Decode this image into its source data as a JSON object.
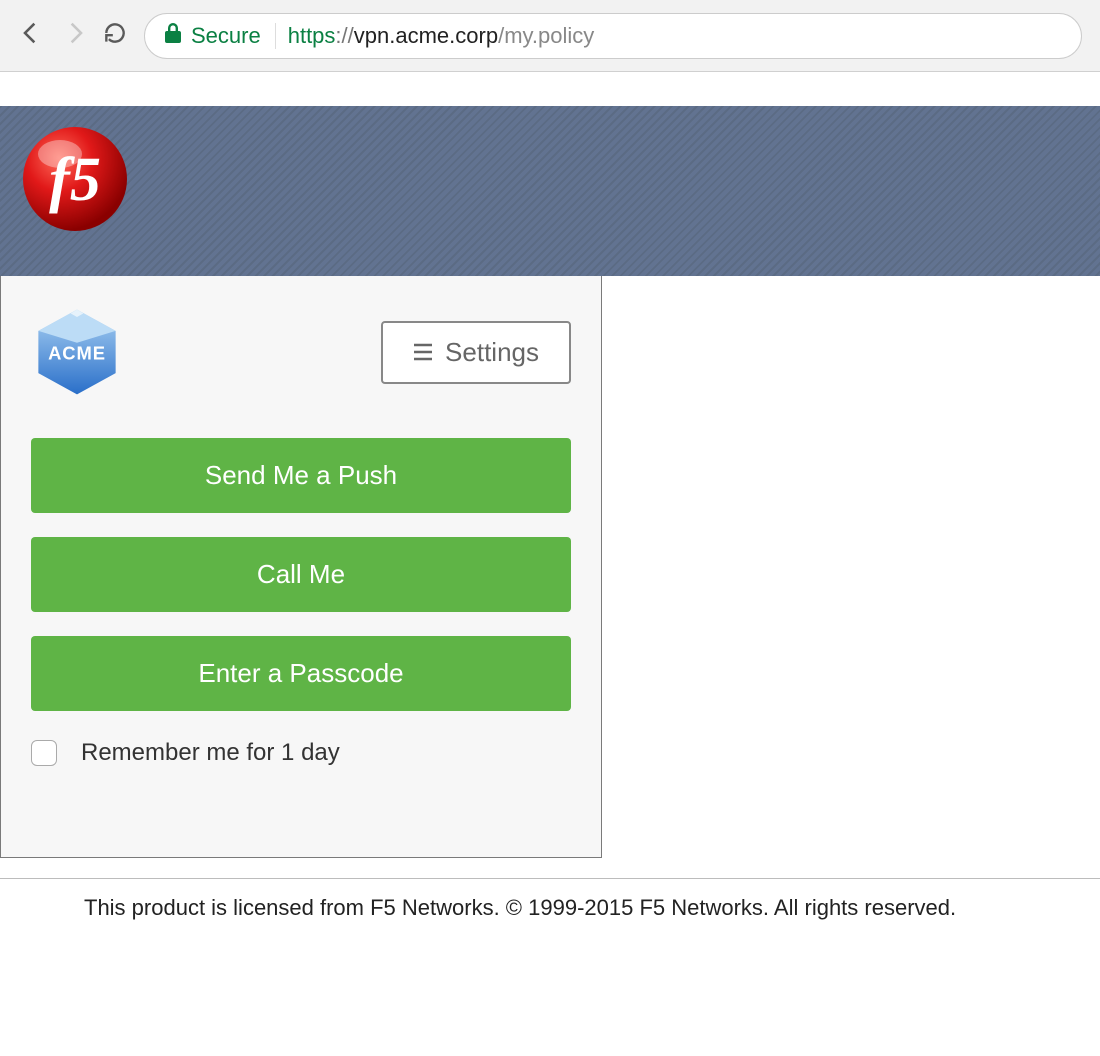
{
  "browser": {
    "secure_label": "Secure",
    "url": {
      "scheme": "https",
      "host": "vpn.acme.corp",
      "path": "/my.policy"
    }
  },
  "banner": {
    "logo_text": "f5"
  },
  "duo": {
    "company_logo_text": "ACME",
    "settings_label": "Settings",
    "actions": {
      "push": "Send Me a Push",
      "call": "Call Me",
      "passcode": "Enter a Passcode"
    },
    "remember_label": "Remember me for 1 day"
  },
  "footer": {
    "text": "This product is licensed from F5 Networks. © 1999-2015 F5 Networks. All rights reserved."
  },
  "colors": {
    "action_green": "#5fb446",
    "secure_green": "#0b8043",
    "banner_slate": "#5b6b84"
  }
}
